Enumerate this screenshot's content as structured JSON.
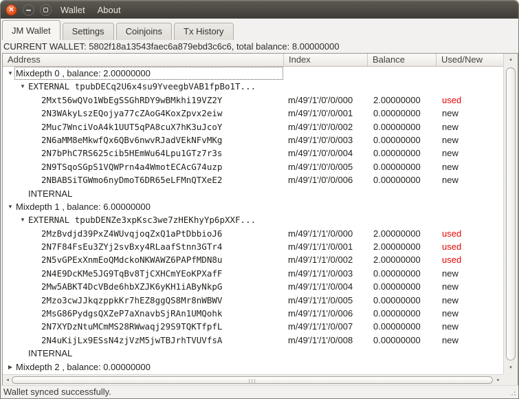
{
  "titlebar": {
    "menu": [
      {
        "label": "Wallet"
      },
      {
        "label": "About"
      }
    ]
  },
  "tabs": [
    {
      "label": "JM Wallet",
      "active": true
    },
    {
      "label": "Settings",
      "active": false
    },
    {
      "label": "Coinjoins",
      "active": false
    },
    {
      "label": "Tx History",
      "active": false
    }
  ],
  "wallet_info": "CURRENT WALLET: 5802f18a13543faec6a879ebd3c6c6, total balance: 8.00000000",
  "tree": {
    "columns": [
      "Address",
      "Index",
      "Balance",
      "Used/New"
    ],
    "rows": [
      {
        "kind": "mixdepth",
        "depth": 0,
        "expander": "open",
        "focused": true,
        "label": "Mixdepth 0 , balance: 2.00000000"
      },
      {
        "kind": "branch",
        "depth": 1,
        "expander": "open",
        "mono": true,
        "label": "EXTERNAL tpubDECq2U6x4su9YveegbVAB1fpBo1T..."
      },
      {
        "kind": "address",
        "depth": 2,
        "label": "2Mxt56wQVo1WbEgSSGhRDY9wBMkhi19VZ2Y",
        "index": "m/49'/1'/0'/0/000",
        "balance": "2.00000000",
        "status": "used"
      },
      {
        "kind": "address",
        "depth": 2,
        "label": "2N3WAkyLszEQojya77cZAoG4KoxZpvx2eiw",
        "index": "m/49'/1'/0'/0/001",
        "balance": "0.00000000",
        "status": "new"
      },
      {
        "kind": "address",
        "depth": 2,
        "label": "2Muc7WnciVoA4k1UUT5qPA8cuX7hK3uJcoY",
        "index": "m/49'/1'/0'/0/002",
        "balance": "0.00000000",
        "status": "new"
      },
      {
        "kind": "address",
        "depth": 2,
        "label": "2N6aMM8eMkwfQx6QBv6nwvRJadVEkNFvMKg",
        "index": "m/49'/1'/0'/0/003",
        "balance": "0.00000000",
        "status": "new"
      },
      {
        "kind": "address",
        "depth": 2,
        "label": "2N7bPhC7RS625cib5HEmWu64Lpu1GTz7r3s",
        "index": "m/49'/1'/0'/0/004",
        "balance": "0.00000000",
        "status": "new"
      },
      {
        "kind": "address",
        "depth": 2,
        "label": "2N9TSqoSGpS1VQWPrn4a4WmotECAcG74uzp",
        "index": "m/49'/1'/0'/0/005",
        "balance": "0.00000000",
        "status": "new"
      },
      {
        "kind": "address",
        "depth": 2,
        "label": "2NBABSiTGWmo6nyDmoT6DR65eLFMnQTXeE2",
        "index": "m/49'/1'/0'/0/006",
        "balance": "0.00000000",
        "status": "new"
      },
      {
        "kind": "branch",
        "depth": 1,
        "label": "INTERNAL"
      },
      {
        "kind": "mixdepth",
        "depth": 0,
        "expander": "open",
        "label": "Mixdepth 1 , balance: 6.00000000"
      },
      {
        "kind": "branch",
        "depth": 1,
        "expander": "open",
        "mono": true,
        "label": "EXTERNAL tpubDENZe3xpKsc3we7zHEKhyYp6pXXF..."
      },
      {
        "kind": "address",
        "depth": 2,
        "label": "2MzBvdjd39PxZ4WUvqjoqZxQ1aPtDbbioJ6",
        "index": "m/49'/1'/1'/0/000",
        "balance": "2.00000000",
        "status": "used"
      },
      {
        "kind": "address",
        "depth": 2,
        "label": "2N7F84FsEu3ZYj2svBxy4RLaafStnn3GTr4",
        "index": "m/49'/1'/1'/0/001",
        "balance": "2.00000000",
        "status": "used"
      },
      {
        "kind": "address",
        "depth": 2,
        "label": "2N5vGPExXnmEoQMdckoNKWAWZ6PAPfMDN8u",
        "index": "m/49'/1'/1'/0/002",
        "balance": "2.00000000",
        "status": "used"
      },
      {
        "kind": "address",
        "depth": 2,
        "label": "2N4E9DcKMe5JG9TqBv8TjCXHCmYEoKPXafF",
        "index": "m/49'/1'/1'/0/003",
        "balance": "0.00000000",
        "status": "new"
      },
      {
        "kind": "address",
        "depth": 2,
        "label": "2Mw5ABKT4DcVBde6hbXZJK6yKH1iAByNkpG",
        "index": "m/49'/1'/1'/0/004",
        "balance": "0.00000000",
        "status": "new"
      },
      {
        "kind": "address",
        "depth": 2,
        "label": "2Mzo3cwJJkqzppkKr7hEZ8ggQS8Mr8nWBWV",
        "index": "m/49'/1'/1'/0/005",
        "balance": "0.00000000",
        "status": "new"
      },
      {
        "kind": "address",
        "depth": 2,
        "label": "2MsG86PydgsQXZeP7aXnavbSjRAn1UMQohk",
        "index": "m/49'/1'/1'/0/006",
        "balance": "0.00000000",
        "status": "new"
      },
      {
        "kind": "address",
        "depth": 2,
        "label": "2N7XYDzNtuMCmMS28RWwaqj29S9TQKTfpfL",
        "index": "m/49'/1'/1'/0/007",
        "balance": "0.00000000",
        "status": "new"
      },
      {
        "kind": "address",
        "depth": 2,
        "label": "2N4uKijLx9ESsN4zjVzM5jwTBJrhTVUVfsA",
        "index": "m/49'/1'/1'/0/008",
        "balance": "0.00000000",
        "status": "new"
      },
      {
        "kind": "branch",
        "depth": 1,
        "label": "INTERNAL"
      },
      {
        "kind": "mixdepth",
        "depth": 0,
        "expander": "closed",
        "label": "Mixdepth 2 , balance: 0.00000000"
      }
    ]
  },
  "statusbar": {
    "text": "Wallet synced successfully."
  },
  "icons": {
    "expander_open": "▼",
    "expander_closed": "▶",
    "close_glyph": "✕",
    "scroll_up": "▴",
    "scroll_down": "▾",
    "scroll_left": "◂",
    "scroll_right": "▸"
  },
  "colors": {
    "used_text": "#E30505",
    "new_text": "#211F1B",
    "close_button": "#DF4B16",
    "titlebar": "#4A4840",
    "selection_focus": "#56534D"
  }
}
